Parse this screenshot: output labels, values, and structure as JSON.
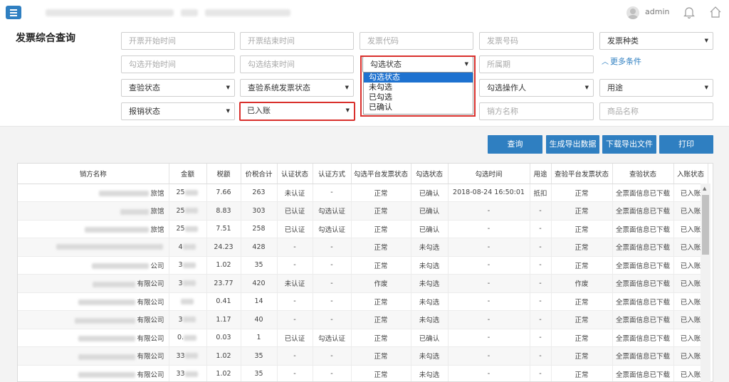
{
  "header": {
    "user_name": "admin",
    "icons": {
      "menu": "menu-icon",
      "avatar": "avatar-icon",
      "bell": "bell-icon",
      "home": "home-icon"
    }
  },
  "page_title": "发票综合查询",
  "filters": {
    "row1": [
      {
        "kind": "input",
        "placeholder": "开票开始时间"
      },
      {
        "kind": "input",
        "placeholder": "开票结束时间"
      },
      {
        "kind": "input",
        "placeholder": "发票代码"
      },
      {
        "kind": "input",
        "placeholder": "发票号码"
      },
      {
        "kind": "select",
        "value": "发票种类"
      }
    ],
    "row2": [
      {
        "kind": "input",
        "placeholder": "勾选开始时间"
      },
      {
        "kind": "input",
        "placeholder": "勾选结束时间"
      },
      {
        "kind": "select",
        "value": "勾选状态"
      },
      {
        "kind": "input",
        "placeholder": "所属期"
      }
    ],
    "row3": [
      {
        "kind": "select",
        "value": "查验状态"
      },
      {
        "kind": "select",
        "value": "查验系统发票状态"
      },
      {
        "kind": "select",
        "value": "勾选操作人"
      },
      {
        "kind": "select",
        "value": "用途"
      }
    ],
    "row4": [
      {
        "kind": "select",
        "value": "报销状态"
      },
      {
        "kind": "select",
        "value": "已入账"
      },
      {
        "kind": "input",
        "placeholder": "销方名称"
      },
      {
        "kind": "input",
        "placeholder": "商品名称"
      }
    ],
    "more_conditions": "更多条件",
    "dropdown_options": [
      "勾选状态",
      "未勾选",
      "已勾选",
      "已确认"
    ]
  },
  "buttons": {
    "query": "查询",
    "export": "生成导出数据",
    "download": "下载导出文件",
    "print": "打印"
  },
  "table": {
    "columns": [
      "销方名称",
      "金额",
      "税额",
      "价税合计",
      "认证状态",
      "认证方式",
      "勾选平台发票状态",
      "勾选状态",
      "勾选时间",
      "用途",
      "查验平台发票状态",
      "查验状态",
      "入账状态"
    ],
    "rows": [
      {
        "name": "旅馆",
        "amount": "25",
        "tax": "7.66",
        "total": "263",
        "auth": "未认证",
        "method": "-",
        "platform": "正常",
        "check": "已确认",
        "time": "2018-08-24 16:50:01",
        "use": "抵扣",
        "vplatform": "正常",
        "verify": "全票面信息已下载",
        "entry": "已入账"
      },
      {
        "name": "旅馆",
        "amount": "25",
        "tax": "8.83",
        "total": "303",
        "auth": "已认证",
        "method": "勾选认证",
        "platform": "正常",
        "check": "已确认",
        "time": "-",
        "use": "-",
        "vplatform": "正常",
        "verify": "全票面信息已下载",
        "entry": "已入账"
      },
      {
        "name": "旅馆",
        "amount": "25",
        "tax": "7.51",
        "total": "258",
        "auth": "已认证",
        "method": "勾选认证",
        "platform": "正常",
        "check": "已确认",
        "time": "-",
        "use": "-",
        "vplatform": "正常",
        "verify": "全票面信息已下载",
        "entry": "已入账"
      },
      {
        "name": "",
        "amount": "4",
        "tax": "24.23",
        "total": "428",
        "auth": "-",
        "method": "-",
        "platform": "正常",
        "check": "未勾选",
        "time": "-",
        "use": "-",
        "vplatform": "正常",
        "verify": "全票面信息已下载",
        "entry": "已入账"
      },
      {
        "name": "公司",
        "amount": "3",
        "tax": "1.02",
        "total": "35",
        "auth": "-",
        "method": "-",
        "platform": "正常",
        "check": "未勾选",
        "time": "-",
        "use": "-",
        "vplatform": "正常",
        "verify": "全票面信息已下载",
        "entry": "已入账"
      },
      {
        "name": "有限公司",
        "amount": "3",
        "tax": "23.77",
        "total": "420",
        "auth": "未认证",
        "method": "-",
        "platform": "作废",
        "check": "未勾选",
        "time": "-",
        "use": "-",
        "vplatform": "作废",
        "verify": "全票面信息已下载",
        "entry": "已入账"
      },
      {
        "name": "有限公司",
        "amount": "",
        "tax": "0.41",
        "total": "14",
        "auth": "-",
        "method": "-",
        "platform": "正常",
        "check": "未勾选",
        "time": "-",
        "use": "-",
        "vplatform": "正常",
        "verify": "全票面信息已下载",
        "entry": "已入账"
      },
      {
        "name": "有限公司",
        "amount": "3",
        "tax": "1.17",
        "total": "40",
        "auth": "-",
        "method": "-",
        "platform": "正常",
        "check": "未勾选",
        "time": "-",
        "use": "-",
        "vplatform": "正常",
        "verify": "全票面信息已下载",
        "entry": "已入账"
      },
      {
        "name": "有限公司",
        "amount": "0.",
        "tax": "0.03",
        "total": "1",
        "auth": "已认证",
        "method": "勾选认证",
        "platform": "正常",
        "check": "已确认",
        "time": "-",
        "use": "-",
        "vplatform": "正常",
        "verify": "全票面信息已下载",
        "entry": "已入账"
      },
      {
        "name": "有限公司",
        "amount": "33",
        "tax": "1.02",
        "total": "35",
        "auth": "-",
        "method": "-",
        "platform": "正常",
        "check": "未勾选",
        "time": "-",
        "use": "-",
        "vplatform": "正常",
        "verify": "全票面信息已下载",
        "entry": "已入账"
      },
      {
        "name": "有限公司",
        "amount": "33",
        "tax": "1.02",
        "total": "35",
        "auth": "-",
        "method": "-",
        "platform": "正常",
        "check": "未勾选",
        "time": "-",
        "use": "-",
        "vplatform": "正常",
        "verify": "全票面信息已下载",
        "entry": "已入账"
      }
    ]
  }
}
